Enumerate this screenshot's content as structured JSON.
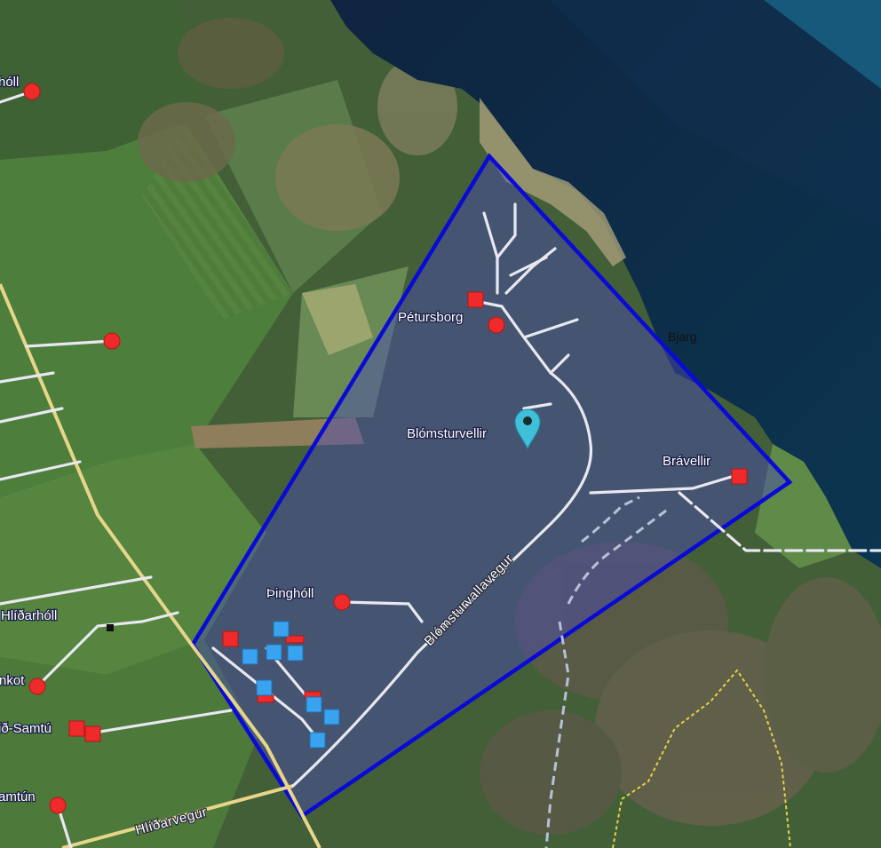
{
  "map": {
    "place_labels": {
      "petursborg": "Pétursborg",
      "blomsturvellir": "Blómsturvellir",
      "bravellir": "Brávellir",
      "thingholl": "Þinghóll",
      "hlidarholl": "Hlíðarhóll",
      "bjarg": "Bjarg",
      "holl_cut": "hóll",
      "nkot_cut": "nkot",
      "samtun_cut": "ið-Samtú",
      "amtun_cut": "amtún"
    },
    "road_labels": {
      "blomsturvallavegur": "Blómsturvallavegur",
      "hlidarvegur": "Hlíðarvegur"
    },
    "colors": {
      "polygon_outline": "#0a0ad6",
      "polygon_fill": "#4a4ab8",
      "point_marker": "#ee2a2a",
      "building_red": "#ee2a2a",
      "building_blue": "#3aa3f0",
      "location_pin": "#3fbfd8",
      "sea": "#0d2a45",
      "road_major": "#e6d58a",
      "road_local": "#e8e8f0"
    },
    "icons": {
      "location_pin": "map-pin-icon",
      "point_marker": "circle-marker",
      "building": "square-marker"
    }
  }
}
